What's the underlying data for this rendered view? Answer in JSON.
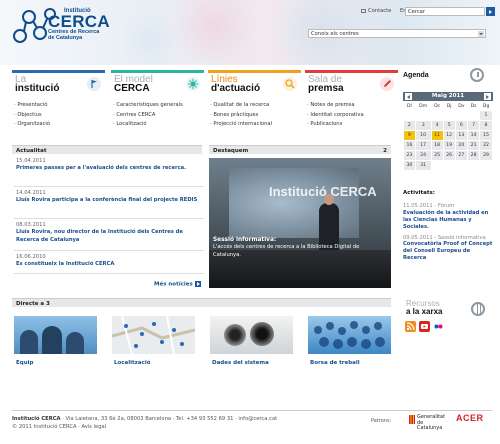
{
  "header": {
    "logo": {
      "line1": "Institució",
      "line2": "CERCA",
      "line3a": "Centres de Recerca",
      "line3b": "de Catalunya"
    },
    "links": [
      "Contacte",
      "English"
    ],
    "search": {
      "value": "Cercar"
    },
    "centres_select": {
      "value": "Conoix els centres"
    }
  },
  "sections": [
    {
      "title1": "La",
      "title2": "institució",
      "color": "#2a6ab0",
      "icon": "flag-icon",
      "items": [
        "Presentació",
        "Objectius",
        "Organització"
      ]
    },
    {
      "title1": "El model",
      "title2": "CERCA",
      "color": "#2bb3a3",
      "icon": "network-icon",
      "items": [
        "Característiques generals",
        "Centres CERCA",
        "Localització"
      ]
    },
    {
      "title1": "Línies",
      "title2": "d'actuació",
      "color": "#f0a21e",
      "icon": "magnifier-icon",
      "items": [
        "Qualitat de la recerca",
        "Bones pràctiques",
        "Projecció internacional"
      ]
    },
    {
      "title1": "Sala de",
      "title2": "premsa",
      "color": "#e23b3b",
      "icon": "pencil-icon",
      "items": [
        "Notes de premsa",
        "Identitat corporativa",
        "Publicacions"
      ]
    }
  ],
  "agenda": {
    "title": "Agenda",
    "month": "Maig 2011",
    "weekdays": [
      "Dl",
      "Dm",
      "Dc",
      "Dj",
      "Dv",
      "Ds",
      "Dg"
    ],
    "weeks": [
      [
        "",
        "",
        "",
        "",
        "",
        "",
        "1"
      ],
      [
        "2",
        "3",
        "4",
        "5",
        "6",
        "7",
        "8"
      ],
      [
        "9",
        "10",
        "11",
        "12",
        "13",
        "14",
        "15"
      ],
      [
        "16",
        "17",
        "18",
        "19",
        "20",
        "21",
        "22"
      ],
      [
        "23",
        "24",
        "25",
        "26",
        "27",
        "28",
        "29"
      ],
      [
        "30",
        "31",
        "",
        "",
        "",
        "",
        ""
      ]
    ],
    "highlight_color": "#f5c40a"
  },
  "activitats": {
    "title": "Activitats:",
    "items": [
      {
        "date": "11.05.2011 - Fòrum",
        "title": "Evaluación de la actividad en las Ciencias Humanas y Sociales."
      },
      {
        "date": "09.05.2011 - Sessió informativa",
        "title": "Convocatòria Proof of Concept del Consell Europeu de Recerca"
      }
    ]
  },
  "actualitat": {
    "title": "Actualitat",
    "items": [
      {
        "date": "15.04.2011",
        "title": "Primeres passes per a l'avaluació dels centres de recerca."
      },
      {
        "date": "14.04.2011",
        "title": "Lluís Rovira participa a la conferència final del projecte REDIS"
      },
      {
        "date": "08.03.2011",
        "title": "Lluís Rovira, nou director de la Institució dels Centres de Recerca de Catalunya"
      },
      {
        "date": "16.06.2010",
        "title": "Es constitueix la Institució CERCA"
      }
    ],
    "more": "Més notícies"
  },
  "destaquem": {
    "title": "Destaquem",
    "count": "2",
    "screen_title": "Institució CERCA",
    "caption_title": "Sessió informativa:",
    "caption_text": "L'accés dels centres de recerca a la Biblioteca Digital de Catalunya."
  },
  "directe": {
    "title": "Directe a 3",
    "tiles": [
      "Equip",
      "Localització",
      "Dades del sistema",
      "Borsa de treball"
    ]
  },
  "recursos": {
    "title1": "Recursos",
    "title2": "a la xarxa"
  },
  "footer": {
    "org": "Institució CERCA",
    "address": " · Via Laietana, 33 6è 2a, 08003 Barcelona · Tel. +34 93 552 69 31 · info@cerca.cat",
    "copyright": "© 2011 Institució CERCA · Avís legal",
    "patrons": "Patrons:",
    "gencat1": "Generalitat",
    "gencat2": "de Catalunya",
    "acer": "ACER"
  }
}
